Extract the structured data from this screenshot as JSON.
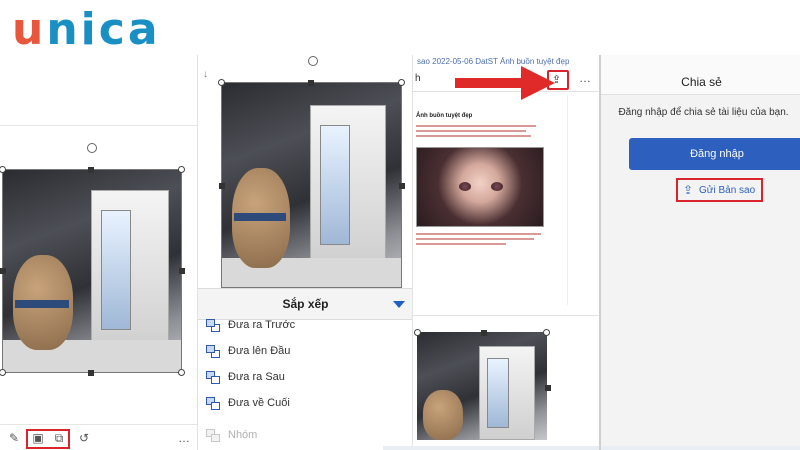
{
  "logo": {
    "first": "u",
    "rest": "nica"
  },
  "panel1": {
    "toolbar_icons": [
      "pen-edit-icon",
      "group-frame-icon",
      "arrange-icon",
      "undo-icon",
      "more-icon"
    ],
    "more_label": "…"
  },
  "panel2": {
    "sort_title": "Sắp xếp",
    "menu_items": [
      {
        "label": "Đưa ra Trước",
        "enabled": true
      },
      {
        "label": "Đưa lên Đầu",
        "enabled": true
      },
      {
        "label": "Đưa ra Sau",
        "enabled": true
      },
      {
        "label": "Đưa về Cuối",
        "enabled": true
      },
      {
        "label": "Nhóm",
        "enabled": false
      }
    ]
  },
  "panel3": {
    "doc_title": "sao 2022-05-06 DatST Ảnh buồn tuyệt đẹp",
    "partial_label": "h",
    "more_label": "…",
    "doc_heading": "Ảnh buồn tuyệt đẹp"
  },
  "panel4": {
    "title": "Chia sẻ",
    "description": "Đăng nhập để chia sẻ tài liệu của bạn.",
    "login_label": "Đăng nhập",
    "send_copy_label": "Gửi Bản sao"
  },
  "colors": {
    "highlight_red": "#d9232d",
    "accent_blue": "#2d5fbf",
    "logo_orange": "#e8573b",
    "logo_blue": "#1a8fc4"
  }
}
